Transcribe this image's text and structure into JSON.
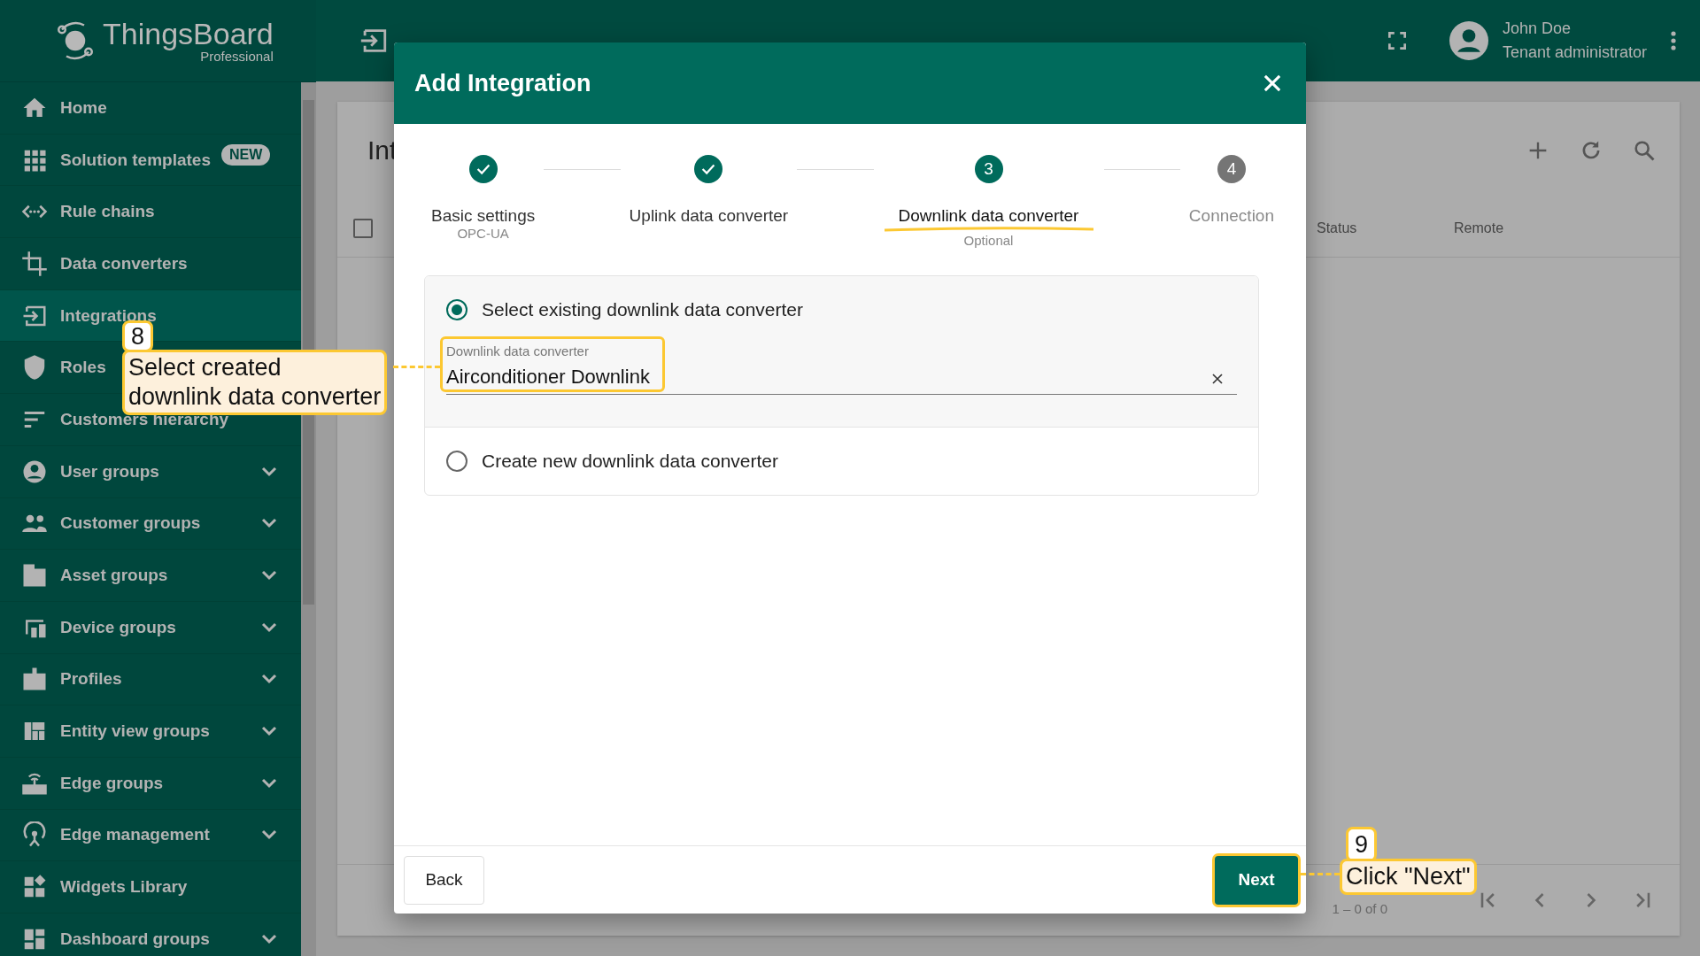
{
  "app": {
    "logo": "ThingsBoard",
    "edition": "Professional"
  },
  "header": {
    "user_name": "John Doe",
    "user_role": "Tenant administrator"
  },
  "sidebar": {
    "items": [
      {
        "label": "Home",
        "selected": false,
        "expandable": false
      },
      {
        "label": "Solution templates",
        "badge": "NEW",
        "selected": false,
        "expandable": false
      },
      {
        "label": "Rule chains",
        "selected": false,
        "expandable": false
      },
      {
        "label": "Data converters",
        "selected": false,
        "expandable": false
      },
      {
        "label": "Integrations",
        "selected": true,
        "expandable": false
      },
      {
        "label": "Roles",
        "selected": false,
        "expandable": false
      },
      {
        "label": "Customers hierarchy",
        "selected": false,
        "expandable": false
      },
      {
        "label": "User groups",
        "selected": false,
        "expandable": true
      },
      {
        "label": "Customer groups",
        "selected": false,
        "expandable": true
      },
      {
        "label": "Asset groups",
        "selected": false,
        "expandable": true
      },
      {
        "label": "Device groups",
        "selected": false,
        "expandable": true
      },
      {
        "label": "Profiles",
        "selected": false,
        "expandable": true
      },
      {
        "label": "Entity view groups",
        "selected": false,
        "expandable": true
      },
      {
        "label": "Edge groups",
        "selected": false,
        "expandable": true
      },
      {
        "label": "Edge management",
        "selected": false,
        "expandable": true
      },
      {
        "label": "Widgets Library",
        "selected": false,
        "expandable": false
      },
      {
        "label": "Dashboard groups",
        "selected": false,
        "expandable": true
      }
    ]
  },
  "page": {
    "title": "Int",
    "select_all": {
      "checked": false
    },
    "columns": [
      {
        "label": "Status"
      },
      {
        "label": "Remote"
      }
    ],
    "paginator": "1 – 0 of 0"
  },
  "dialog": {
    "title": "Add Integration",
    "steps": [
      {
        "label": "Basic settings",
        "sublabel": "OPC-UA",
        "completed": true,
        "selected": false
      },
      {
        "label": "Uplink data converter",
        "completed": true,
        "selected": false
      },
      {
        "label": "Downlink data converter",
        "sublabel": "Optional",
        "completed": false,
        "selected": true,
        "number": "3"
      },
      {
        "label": "Connection",
        "completed": false,
        "selected": false,
        "number": "4"
      }
    ],
    "options": [
      {
        "label": "Select existing downlink data converter",
        "selected": true
      },
      {
        "label": "Create new downlink data converter",
        "selected": false
      }
    ],
    "field": {
      "label": "Downlink data converter",
      "value": "Airconditioner Downlink"
    },
    "back_button": "Back",
    "next_button": "Next"
  },
  "annotations": [
    {
      "number": "8",
      "lines": [
        "Select created",
        "downlink data converter"
      ]
    },
    {
      "number": "9",
      "lines": [
        "Click \"Next\""
      ]
    }
  ]
}
